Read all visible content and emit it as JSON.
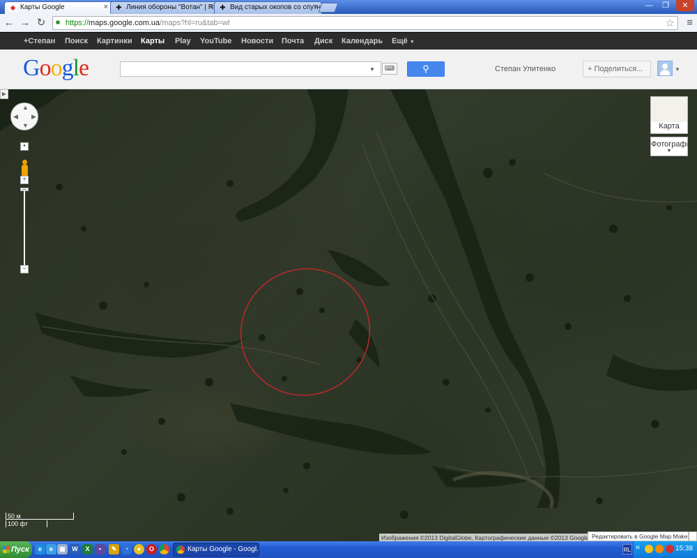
{
  "browser": {
    "tabs": [
      {
        "title": "Карты Google",
        "active": true,
        "icon": "maps-favicon-icon"
      },
      {
        "title": "Линия обороны \"Вотан\" | RE",
        "active": false,
        "icon": "cross-favicon-icon"
      },
      {
        "title": "Вид старых окопов со спутн",
        "active": false,
        "icon": "cross-favicon-icon"
      }
    ],
    "url_scheme": "https://",
    "url_host": "maps.google.com.ua",
    "url_path": "/maps?hl=ru&tab=wl"
  },
  "gbar": {
    "items": [
      "+Степан",
      "Поиск",
      "Картинки",
      "Карты",
      "Play",
      "YouTube",
      "Новости",
      "Почта",
      "Диск",
      "Календарь",
      "Ещё"
    ],
    "selected": "Карты"
  },
  "header": {
    "logo_text": "Google",
    "search_value": "",
    "user_name": "Степан Улитенко",
    "share_label": "+ Поделиться..."
  },
  "map": {
    "map_type_label": "Карта",
    "satellite_label": "Фотография",
    "scale_metric": "50 м",
    "scale_imperial": "100 фт",
    "attribution": "Изображения ©2013 DigitalGlobe, Картографические данные ©2013 Google -",
    "mapmaker_link": "Редактировать в Google Map Maker"
  },
  "taskbar": {
    "start_label": "Пуск",
    "active_window": "Карты Google - Googl...",
    "language": "RL",
    "clock": "15:38"
  },
  "colors": {
    "google_blue": "#4787ed",
    "gbar_bg": "#2d2d2d",
    "annotation_red": "#c0282a"
  }
}
